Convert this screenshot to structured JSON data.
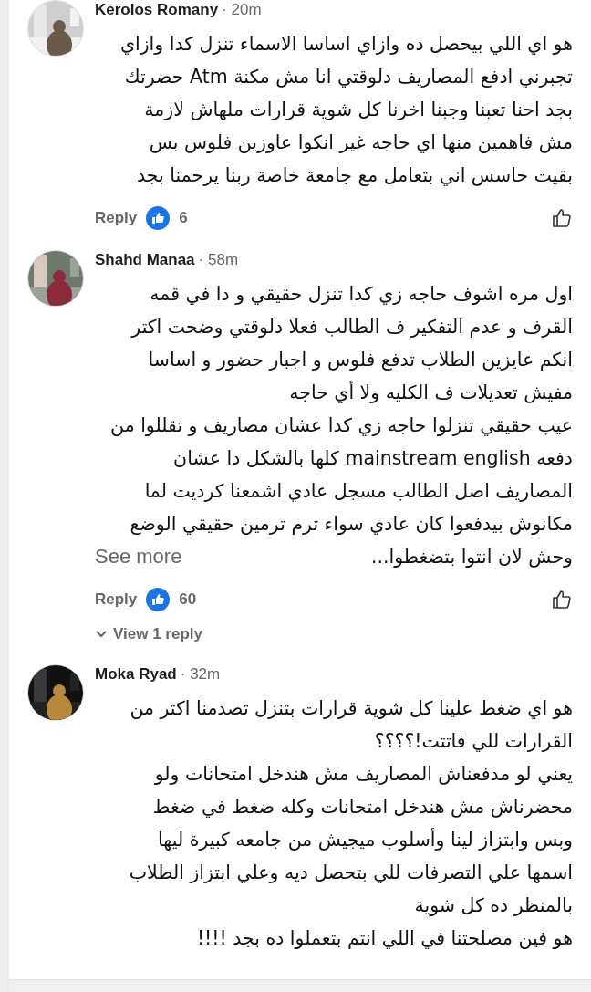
{
  "comments": [
    {
      "author": "Kerolos Romany",
      "time": "· 20m",
      "avatar": {
        "kind": "picture"
      },
      "lines": [
        "هو اي اللي بيحصل ده وازاي اساسا الاسماء تنزل كدا وازاي",
        "تجبرني ادفع المصاريف دلوقتي انا مش مكنة Atm حضرتك",
        "بجد احنا تعبنا وجبنا اخرنا كل شوية قرارات ملهاش لازمة",
        "مش فاهمين منها اي حاجه غير انكوا عاوزين فلوس بس",
        "بقيت حاسس اني بتعامل مع جامعة خاصة ربنا يرحمنا بجد"
      ],
      "reply": "Reply",
      "reaction_count": "6"
    },
    {
      "author": "Shahd Manaa",
      "time": "· 58m",
      "avatar": {
        "kind": "picture"
      },
      "lines": [
        "اول مره اشوف حاجه زي كدا تنزل حقيقي و دا في قمه",
        "القرف و عدم التفكير ف الطالب فعلا دلوقتي وضحت اكتر",
        "انكم عايزين الطلاب تدفع فلوس و اجبار حضور و اساسا",
        "مفيش تعديلات ف الكليه ولا أي حاجه",
        "عيب حقيقي تنزلوا حاجه زي كدا عشان مصاريف و تقللوا من",
        "دفعه mainstream english كلها بالشكل دا عشان",
        "المصاريف اصل الطالب مسجل عادي اشمعنا كرديت لما",
        "مكانوش بيدفعوا كان عادي سواء ترم ترمين حقيقي الوضع",
        "وحش لان انتوا بتضغطوا..."
      ],
      "see_more": "See more",
      "reply": "Reply",
      "reaction_count": "60",
      "view_replies": "View 1 reply"
    },
    {
      "author": "Moka Ryad",
      "time": "· 32m",
      "avatar": {
        "kind": "picture"
      },
      "lines": [
        "هو اي ضغط علينا كل شوية قرارات بتنزل تصدمنا اكتر من",
        "القرارات للي فاتتت!؟؟؟؟",
        "يعني لو مدفعناش المصاريف مش هندخل امتحانات ولو",
        "محضرناش مش هندخل امتحانات وكله ضغط في ضغط",
        "وبس وابتزاز لينا وأسلوب ميجيش من جامعه كبيرة ليها",
        "اسمها علي التصرفات للي بتحصل ديه وعلي ابتزاز الطلاب",
        "بالمنظر ده كل شوية",
        "هو فين مصلحتنا في اللي انتم بتعملوا ده بجد !!!!"
      ]
    }
  ]
}
